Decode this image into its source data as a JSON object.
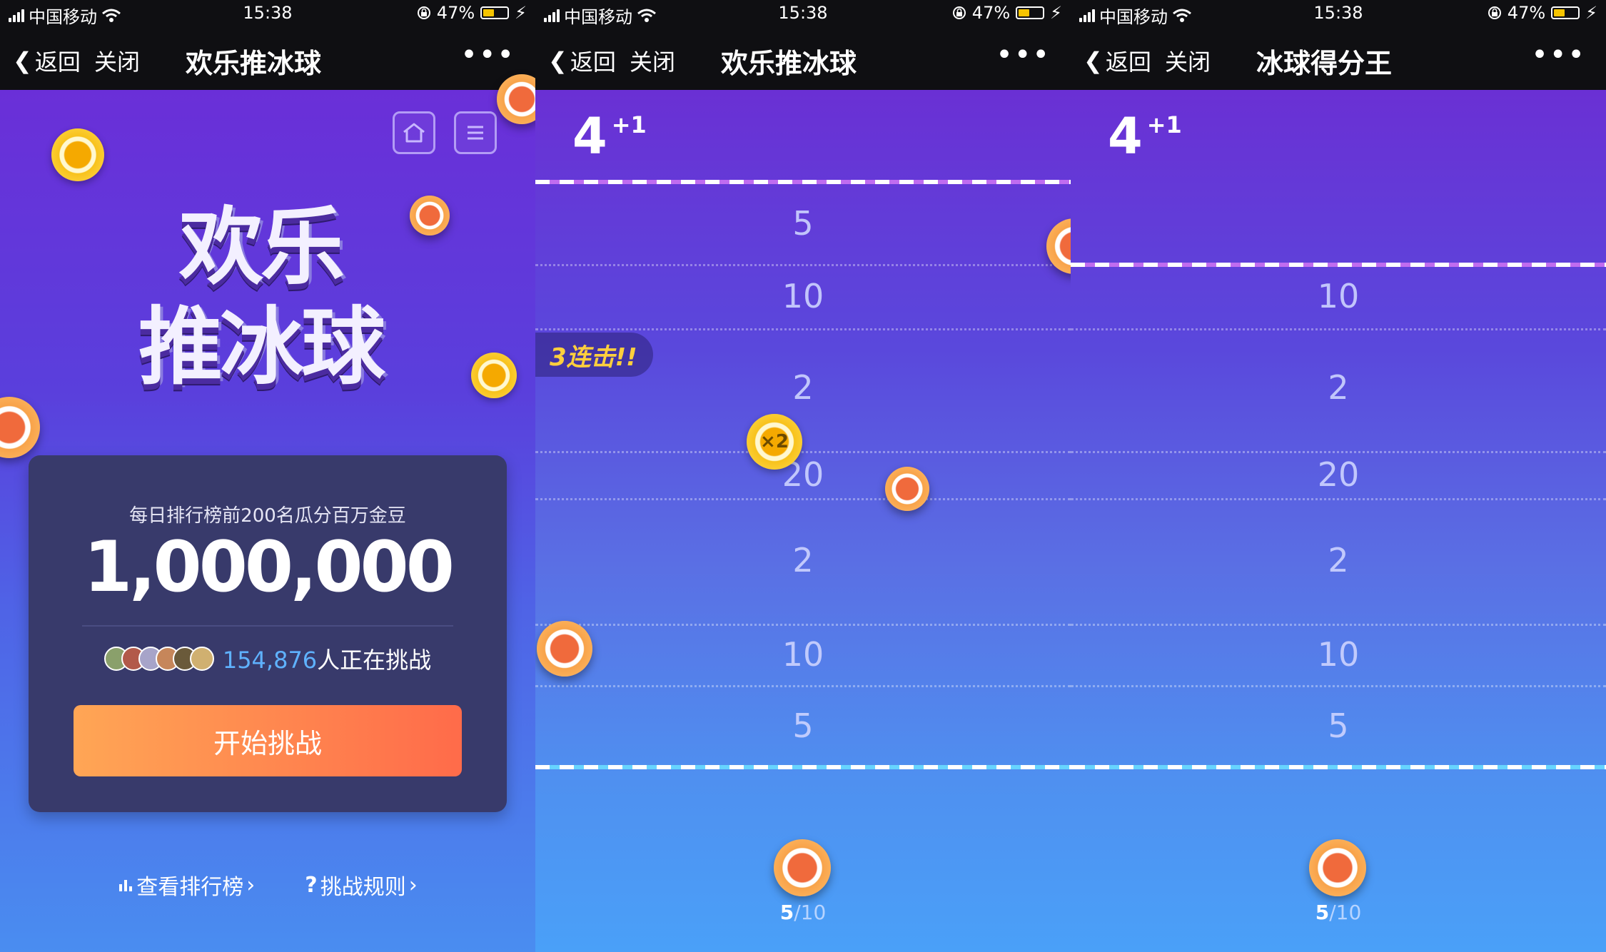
{
  "status_bar": {
    "carrier": "中国移动",
    "time": "15:38",
    "battery": "47%",
    "battery_level": 0.47,
    "icons": [
      "signal-icon",
      "wifi-icon",
      "lock-rotation-icon",
      "battery-icon",
      "charging-icon"
    ]
  },
  "panels": [
    {
      "nav": {
        "back": "返回",
        "close": "关闭",
        "title": "欢乐推冰球",
        "more": "•••"
      },
      "home": {
        "logo_line1": "欢乐",
        "logo_line2": "推冰球",
        "prize_subtitle": "每日排行榜前200名瓜分百万金豆",
        "prize_amount": "1,000,000",
        "challengers_count": "154,876",
        "challengers_suffix": "人正在挑战",
        "start_button": "开始挑战",
        "link_leaderboard": "查看排行榜",
        "link_rules": "挑战规则"
      }
    },
    {
      "nav": {
        "back": "返回",
        "close": "关闭",
        "title": "欢乐推冰球",
        "more": "•••"
      },
      "game": {
        "score": "4",
        "score_bonus": "+1",
        "zones": [
          "5",
          "10",
          "2",
          "20",
          "2",
          "10",
          "5"
        ],
        "combo": "3连击!!",
        "multiplier": "×2",
        "progress_current": "5",
        "progress_total": "/10"
      }
    },
    {
      "nav": {
        "back": "返回",
        "close": "关闭",
        "title": "冰球得分王",
        "more": "•••"
      },
      "game": {
        "score": "4",
        "score_bonus": "+1",
        "zones": [
          "10",
          "2",
          "20",
          "2",
          "10",
          "5"
        ],
        "progress_current": "5",
        "progress_total": "/10"
      }
    }
  ],
  "colors": {
    "bar": "#0f0f12",
    "start_button_from": "#ffa655",
    "start_button_to": "#ff6b4a",
    "count_blue": "#5fb2ff",
    "combo_yellow": "#ffcf3d"
  }
}
